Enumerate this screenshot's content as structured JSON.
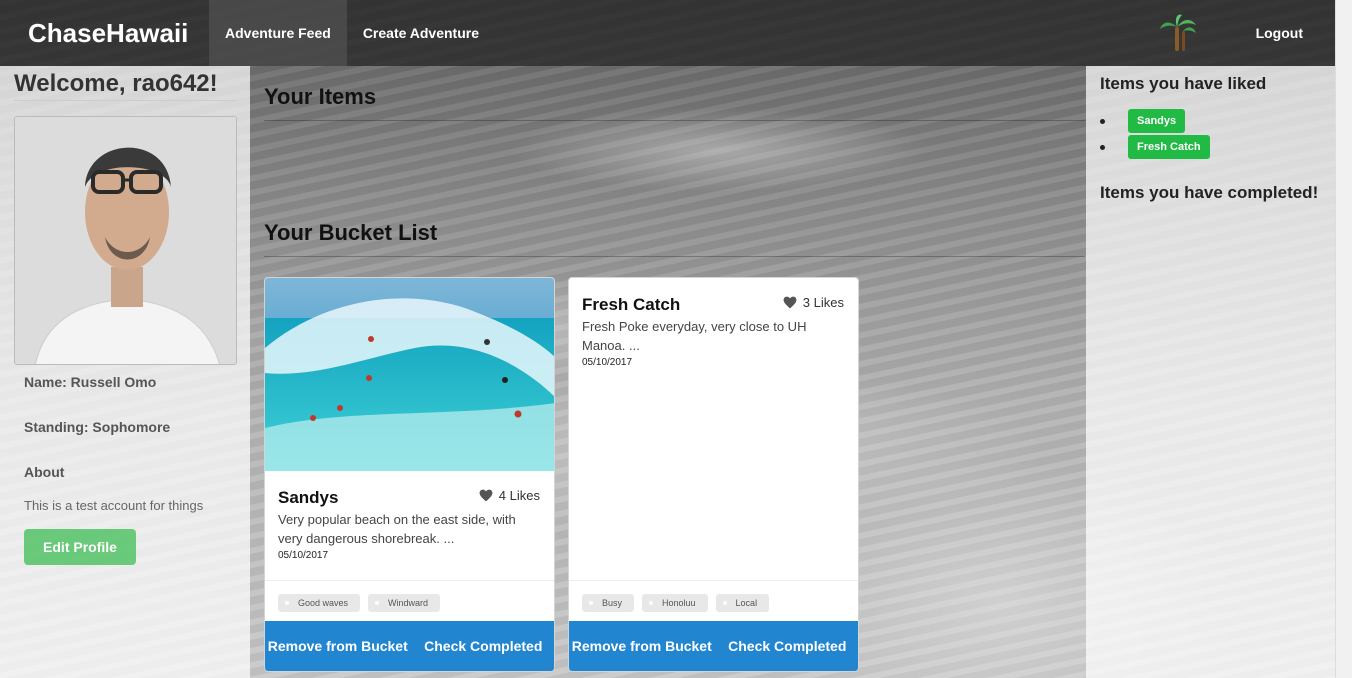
{
  "navbar": {
    "brand": "ChaseHawaii",
    "items": [
      {
        "label": "Adventure Feed",
        "active": true
      },
      {
        "label": "Create Adventure",
        "active": false
      }
    ],
    "logout_label": "Logout"
  },
  "profile": {
    "welcome": "Welcome, rao642!",
    "name": "Name: Russell Omo",
    "standing": "Standing: Sophomore",
    "about_heading": "About",
    "about_text": "This is a test account for things",
    "edit_label": "Edit Profile"
  },
  "sections": {
    "your_items": "Your Items",
    "bucket_list": "Your Bucket List"
  },
  "cards": [
    {
      "title": "Sandys",
      "likes": "4 Likes",
      "description": "Very popular beach on the east side, with very dangerous shorebreak. ...",
      "date": "05/10/2017",
      "tags": [
        "Good waves",
        "Windward"
      ],
      "remove_label": "Remove from Bucket",
      "complete_label": "Check Completed"
    },
    {
      "title": "Fresh Catch",
      "likes": "3 Likes",
      "description": "Fresh Poke everyday, very close to UH Manoa. ...",
      "date": "05/10/2017",
      "tags": [
        "Busy",
        "Honoluu",
        "Local"
      ],
      "remove_label": "Remove from Bucket",
      "complete_label": "Check Completed"
    }
  ],
  "sidebar_right": {
    "liked_title": "Items you have liked",
    "liked_items": [
      "Sandys",
      "Fresh Catch"
    ],
    "completed_title": "Items you have completed!"
  },
  "colors": {
    "primary_button": "#2185d0",
    "liked_badge": "#21ba45",
    "edit_button": "#5cc66e"
  },
  "icons": {
    "logo": "palm-tree-icon",
    "likes": "heart-icon"
  }
}
